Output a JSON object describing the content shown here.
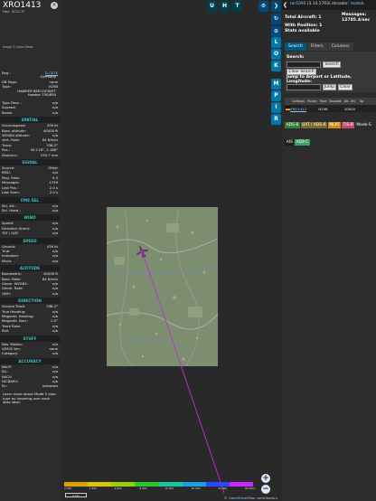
{
  "info": {
    "callsign": "XRO1413",
    "hex_line": "Hex:  3CCC7F",
    "close_glyph": "×",
    "photo_credit": "Image © Julian Maas",
    "reg_label": "Reg.:",
    "reg_value": "D-CETE",
    "country": "Germany",
    "db_flags_label": "DB flags:",
    "db_flags_value": "none",
    "type_label": "Type:",
    "type_value": "H25B",
    "type_desc_1": "HAWKER BEECHCRAFT",
    "type_desc_2": "Hawker 750/850",
    "sections": [
      {
        "title": "",
        "rows": [
          {
            "k": "Type Desc.:",
            "v": "n/a"
          },
          {
            "k": "Squawk:",
            "v": "n/a"
          },
          {
            "k": "Route:",
            "v": "n/a"
          }
        ]
      },
      {
        "title": "SPATIAL",
        "rows": [
          {
            "k": "Groundspeed:",
            "v": "439 kt"
          },
          {
            "k": "Baro. altitude:",
            "v": "40000 ft"
          },
          {
            "k": "WGS84 altitude:",
            "v": "n/a"
          },
          {
            "k": "Vert. Rate:",
            "v": "64 ft/min"
          },
          {
            "k": "Track:",
            "v": "338.2°"
          },
          {
            "k": "Pos.:",
            "v": "50.116°, 2.186°"
          },
          {
            "k": "Distance:",
            "v": "230.7 nmi"
          }
        ]
      },
      {
        "title": "SIGNAL",
        "rows": [
          {
            "k": "Source:",
            "v": "Other"
          },
          {
            "k": "RSSI:",
            "v": "n/a"
          },
          {
            "k": "Msg. Rate:",
            "v": "0.3"
          },
          {
            "k": "Messages:",
            "v": "1759"
          },
          {
            "k": "Last Pos.:",
            "v": "2.0 s"
          },
          {
            "k": "Last Seen:",
            "v": "2.0 s"
          }
        ]
      },
      {
        "title": "FMS SEL",
        "rows": [
          {
            "k": "Sel. Alt.:",
            "v": "n/a"
          },
          {
            "k": "Sel. Head.:",
            "v": "n/a"
          }
        ]
      },
      {
        "title": "WIND",
        "rows": [
          {
            "k": "Speed:",
            "v": "n/a"
          },
          {
            "k": "Direction (from):",
            "v": "n/a"
          },
          {
            "k": "TAT / OAT:",
            "v": "n/a"
          }
        ]
      },
      {
        "title": "SPEED",
        "rows": [
          {
            "k": "Ground:",
            "v": "439 kt"
          },
          {
            "k": "True:",
            "v": "n/a"
          },
          {
            "k": "Indicated:",
            "v": "n/a"
          },
          {
            "k": "Mach:",
            "v": "n/a"
          }
        ]
      },
      {
        "title": "ALTITUDE",
        "rows": [
          {
            "k": "Barometric:",
            "v": "40000 ft"
          },
          {
            "k": "Baro. Rate:",
            "v": "64 ft/min"
          },
          {
            "k": "Geom. WGS84:",
            "v": "n/a"
          },
          {
            "k": "Geom. Rate:",
            "v": "n/a"
          },
          {
            "k": "QNH:",
            "v": "n/a"
          }
        ]
      },
      {
        "title": "DIRECTION",
        "rows": [
          {
            "k": "Ground Track:",
            "v": "338.2°"
          },
          {
            "k": "True Heading:",
            "v": "n/a"
          },
          {
            "k": "Magnetic Heading:",
            "v": "n/a"
          },
          {
            "k": "Magnetic Decl.:",
            "v": "2.0°"
          },
          {
            "k": "Track Rate:",
            "v": "n/a"
          },
          {
            "k": "Roll:",
            "v": "n/a"
          }
        ]
      },
      {
        "title": "STUFF",
        "rows": [
          {
            "k": "Nav. Modes:",
            "v": "n/a"
          },
          {
            "k": "ADS-B Ver.:",
            "v": "none"
          },
          {
            "k": "Category:",
            "v": "n/a"
          }
        ]
      },
      {
        "title": "ACCURACY",
        "rows": [
          {
            "k": "NACP:",
            "v": "n/a"
          },
          {
            "k": "SIL:",
            "v": "n/a"
          },
          {
            "k": "NACV:",
            "v": "n/a"
          },
          {
            "k": "NICBARO:",
            "v": "n/a"
          },
          {
            "k": "Rc:",
            "v": "unknown"
          }
        ]
      }
    ],
    "learn_more": "Learn more about Mode S data type by hovering over each data label."
  },
  "map": {
    "top_buttons": [
      "U",
      "H",
      "T"
    ],
    "side_buttons": [
      "L",
      "O",
      "K",
      "M",
      "P",
      "I",
      "R"
    ],
    "zoom_in": "+",
    "zoom_out": "−",
    "altitude_legend": [
      "2 000",
      "4 000",
      "6 000",
      "8 000",
      "10 000",
      "20 000",
      "30 000",
      "40 000+"
    ],
    "legend_colors": [
      "#e0a000",
      "#d9c800",
      "#9bd000",
      "#2fc62e",
      "#18c8a0",
      "#1aa0e0",
      "#2848ff",
      "#c828ff"
    ],
    "scale_label": "5 km",
    "attribution_prefix": "© ",
    "attribution_link": "OpenStreetMap",
    "attribution_suffix": " contributors."
  },
  "sidebar": {
    "version_prefix": "",
    "version_link": "tar1090",
    "version_rest": " (3.14.1793) decoder: ",
    "version_tail": "readsb",
    "total_aircraft": "Total Aircraft: 1",
    "messages": "Messages:",
    "messages_rate": "12785.4/sec",
    "with_position": "With Position: 1",
    "stats": "Stats available",
    "tabs": [
      "Search",
      "Filters",
      "Columns"
    ],
    "search_label": "Search:",
    "search_button": "Search",
    "clear_search": "Clear Search",
    "jump_label": "Jump to Airport or Latitude, Longitude:",
    "jump_button": "Jump",
    "clear_button": "Clear",
    "table_headers": [
      "",
      "Callsign",
      "Route",
      "Type",
      "Squawk",
      "Alt. (ft)",
      "Sp"
    ],
    "table_row": [
      "",
      "XRO1413",
      "",
      "H25B",
      "",
      "40000",
      ""
    ],
    "filter_chips": [
      {
        "label": "ADS-B",
        "bg": "#3a7d3a"
      },
      {
        "label": "UAT / ADS-R",
        "bg": "#7a6a2a"
      },
      {
        "label": "MLAT",
        "bg": "#d08a1a"
      },
      {
        "label": "TIS-B",
        "bg": "#c44a6a"
      },
      {
        "label": "Mode-S",
        "bg": "#2c2c2c"
      },
      {
        "label": "AIS",
        "bg": "#1f1f1f"
      },
      {
        "label": "ADS-C",
        "bg": "#3aa06a"
      }
    ]
  }
}
